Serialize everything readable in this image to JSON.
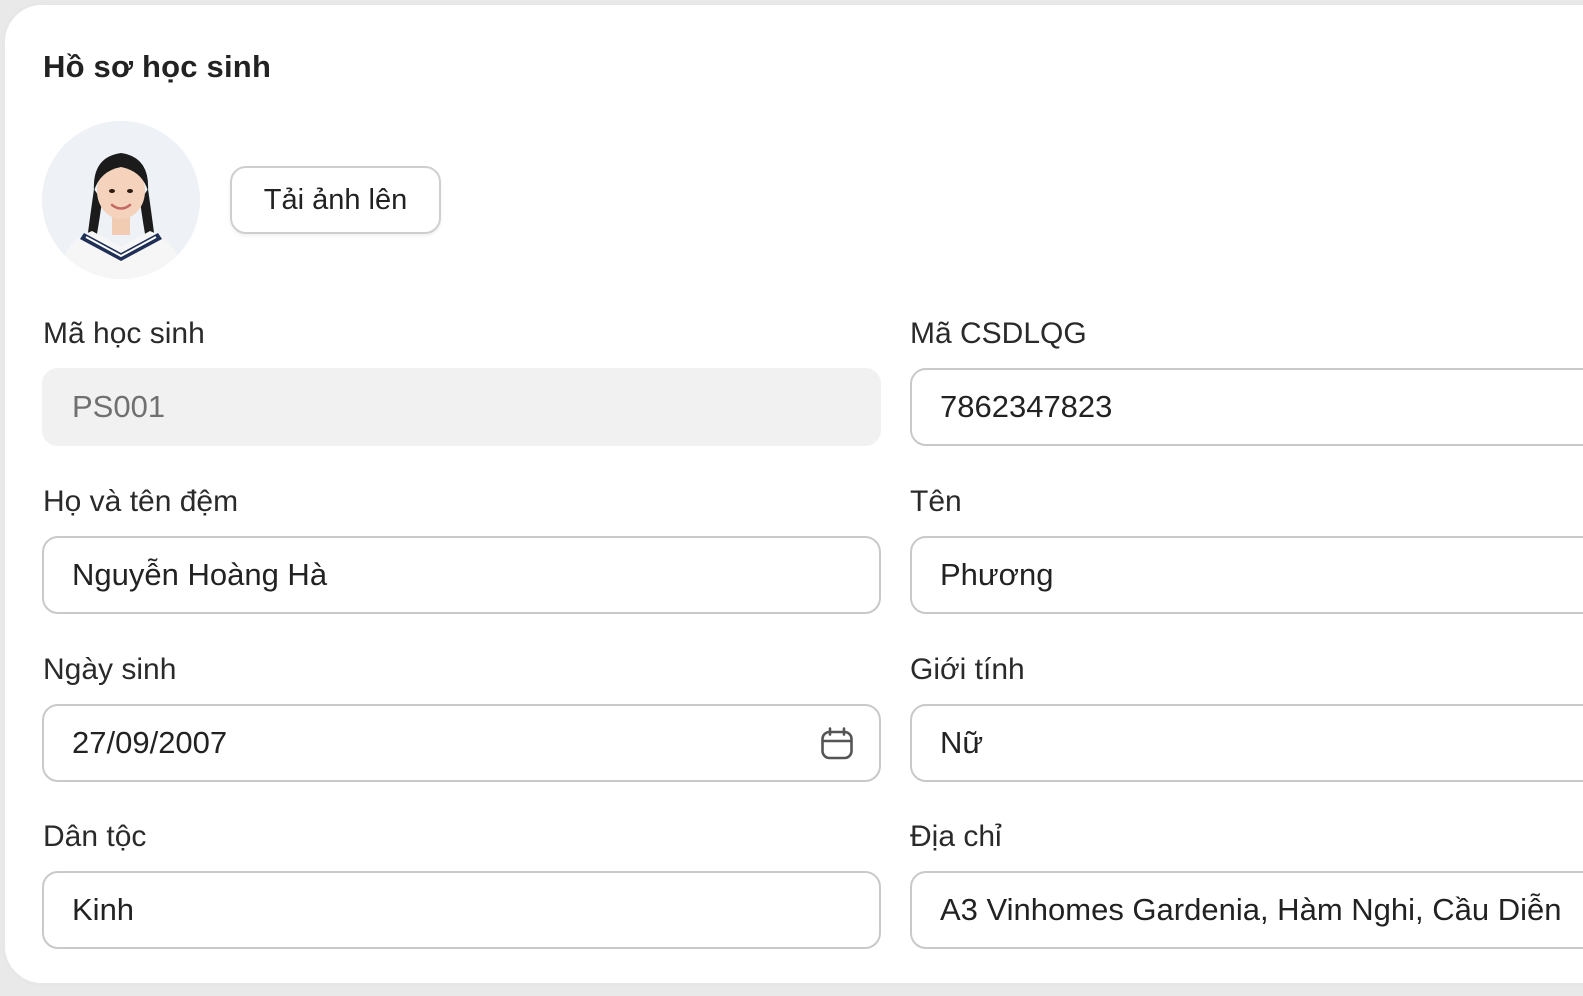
{
  "card": {
    "title": "Hồ sơ học sinh"
  },
  "avatar": {
    "alt": "Ảnh học sinh"
  },
  "upload": {
    "label": "Tải ảnh lên"
  },
  "fields": {
    "student_id": {
      "label": "Mã học sinh",
      "value": "PS001"
    },
    "national_db_id": {
      "label": "Mã CSDLQG",
      "value": "7862347823"
    },
    "last_middle_name": {
      "label": "Họ và tên đệm",
      "value": "Nguyễn Hoàng Hà"
    },
    "first_name": {
      "label": "Tên",
      "value": "Phương"
    },
    "birth_date": {
      "label": "Ngày sinh",
      "value": "27/09/2007"
    },
    "gender": {
      "label": "Giới tính",
      "value": "Nữ"
    },
    "ethnicity": {
      "label": "Dân tộc",
      "value": "Kinh"
    },
    "address": {
      "label": "Địa chỉ",
      "value": "A3 Vinhomes Gardenia, Hàm Nghi, Cầu Diễn"
    }
  },
  "icons": {
    "birth_date_trailing": "calendar-icon"
  },
  "colors": {
    "field_border": "#c9c9c9",
    "disabled_bg": "#f1f1f1",
    "card_border": "#e7e7e7"
  }
}
